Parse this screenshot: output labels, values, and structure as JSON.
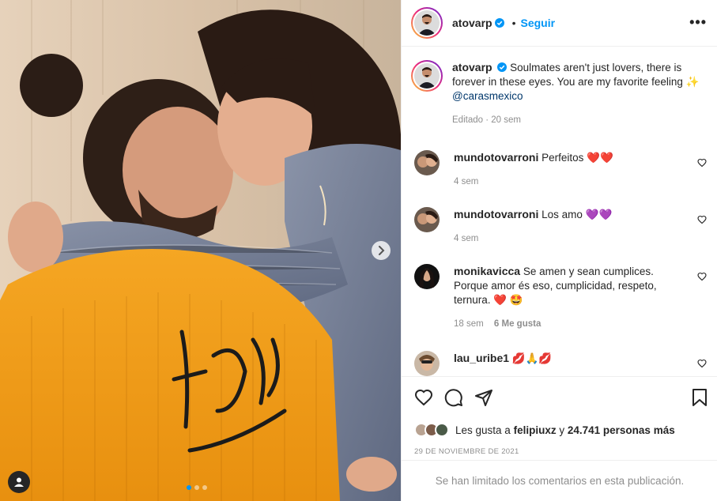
{
  "post": {
    "username": "atovarp",
    "follow_label": "Seguir",
    "separator": "•",
    "more_label": "•••"
  },
  "caption": {
    "username": "atovarp",
    "text": "Soulmates aren't just lovers, there is forever in these eyes. You are my favorite feeling ✨",
    "mention": "@carasmexico",
    "edited": "Editado",
    "time": "20 sem"
  },
  "comments": [
    {
      "username": "mundotovarroni",
      "text": "Perfeitos ❤️❤️",
      "time": "4 sem",
      "likes": ""
    },
    {
      "username": "mundotovarroni",
      "text": "Los amo 💜💜",
      "time": "4 sem",
      "likes": ""
    },
    {
      "username": "monikavicca",
      "text": "Se amen y sean cumplices. Porque amor és eso, cumplicidad, respeto, ternura. ❤️ 🤩",
      "time": "18 sem",
      "likes": "6 Me gusta"
    },
    {
      "username": "lau_uribe1",
      "text": "💋🙏💋",
      "time": "",
      "likes": ""
    }
  ],
  "likes": {
    "prefix": "Les gusta a",
    "user": "felipiuxz",
    "conj": "y",
    "count": "24.741 personas más"
  },
  "date": "29 DE NOVIEMBRE DE 2021",
  "limited_notice": "Se han limitado los comentarios en esta publicación.",
  "colors": {
    "accent": "#0095f6",
    "like_red": "#ed4956",
    "muted": "#8e8e8e"
  }
}
